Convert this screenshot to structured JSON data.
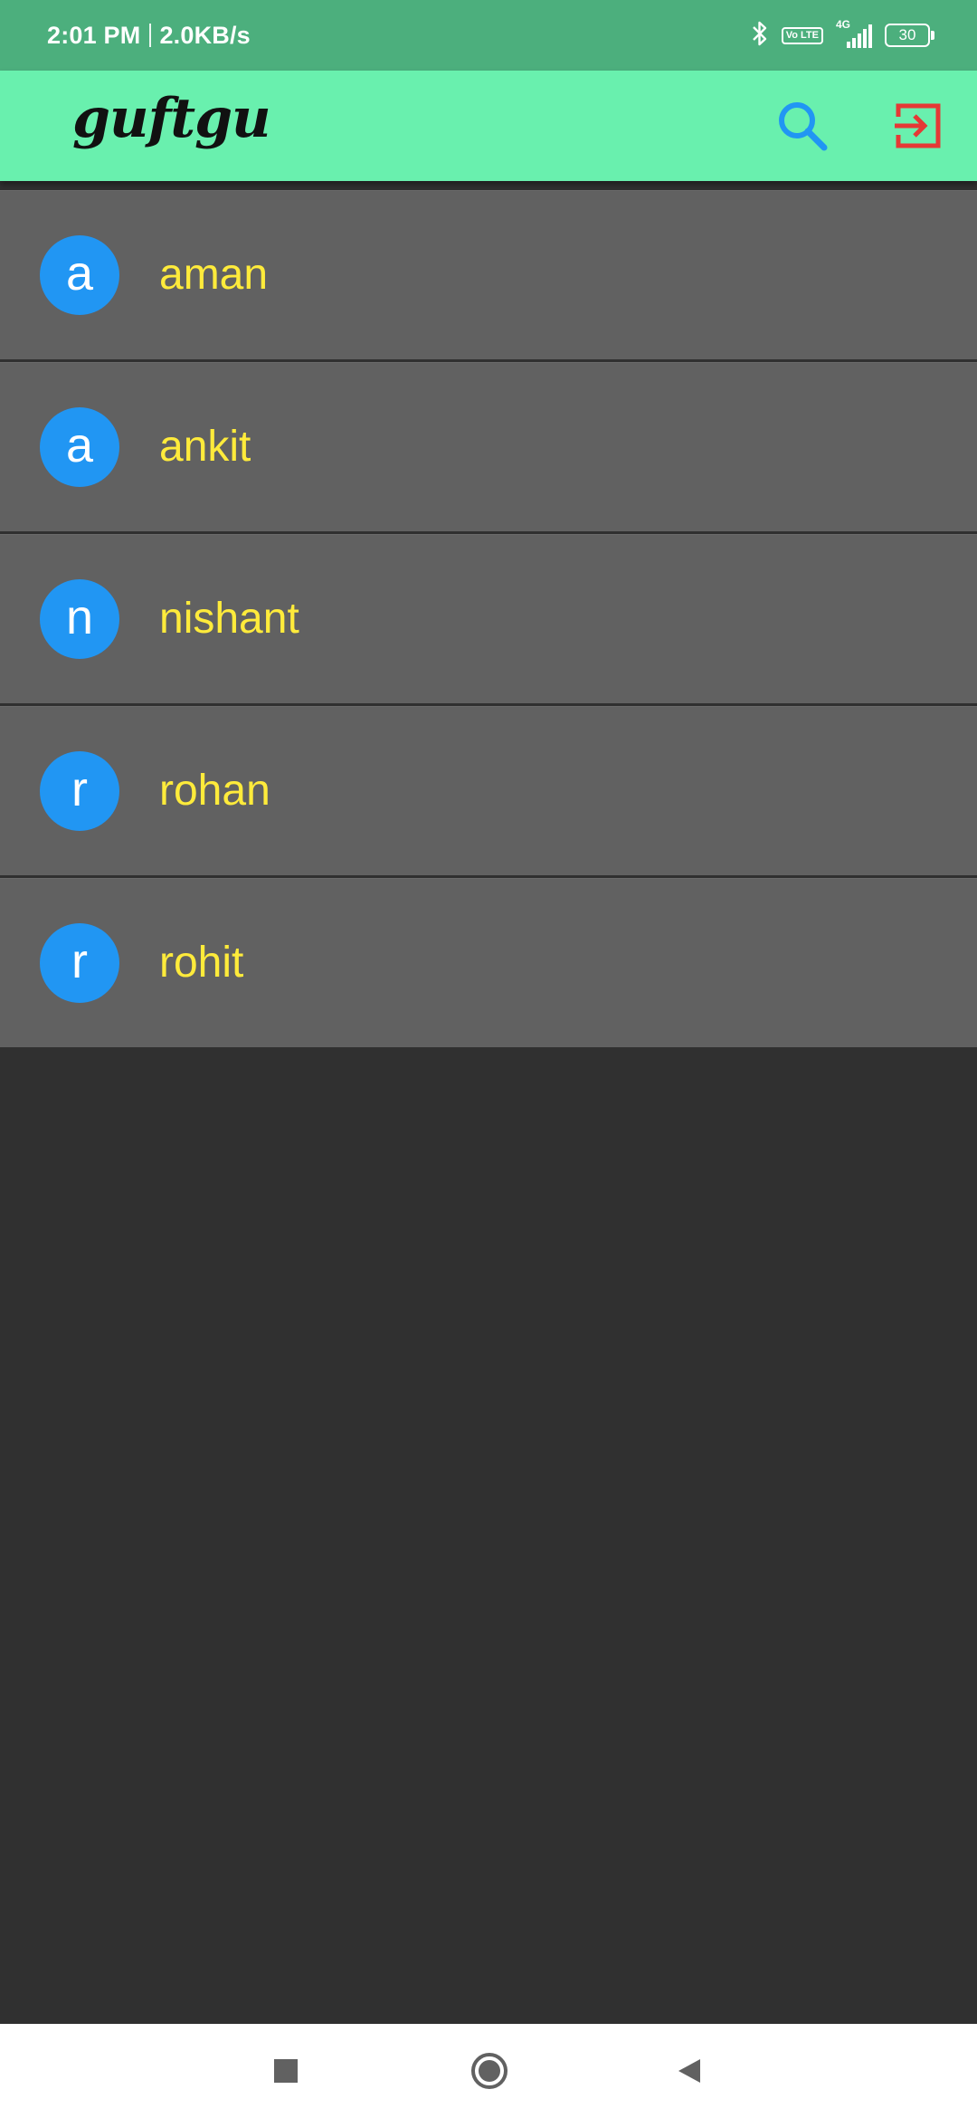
{
  "status_bar": {
    "time": "2:01 PM",
    "speed": "2.0KB/s",
    "volte": "Vo LTE",
    "network": "4G",
    "battery": "30",
    "icons": [
      "bluetooth-icon",
      "volte-icon",
      "signal-icon",
      "battery-icon"
    ]
  },
  "app_bar": {
    "title": "guftgu",
    "actions": [
      {
        "name": "search",
        "icon": "search-icon",
        "color": "#2196f3"
      },
      {
        "name": "logout",
        "icon": "logout-icon",
        "color": "#e53935"
      }
    ],
    "background": "#69f0ae"
  },
  "users": [
    {
      "initial": "a",
      "name": "aman"
    },
    {
      "initial": "a",
      "name": "ankit"
    },
    {
      "initial": "n",
      "name": "nishant"
    },
    {
      "initial": "r",
      "name": "rohan"
    },
    {
      "initial": "r",
      "name": "rohit"
    }
  ],
  "colors": {
    "avatar": "#2196f3",
    "name_text": "#ffeb3b",
    "list_item": "#616161",
    "background": "#303030",
    "status_bar": "#4caf7d"
  },
  "nav_bar": {
    "buttons": [
      "recents-icon",
      "home-icon",
      "back-icon"
    ]
  }
}
